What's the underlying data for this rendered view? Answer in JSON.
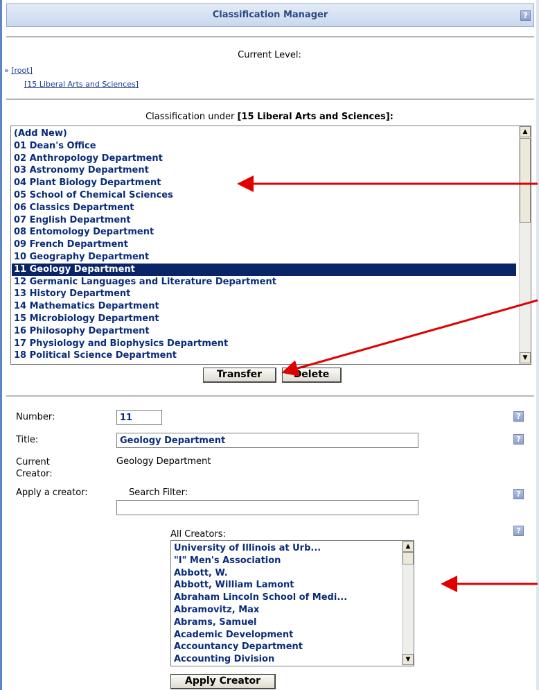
{
  "window": {
    "title": "Classification Manager"
  },
  "level": {
    "heading": "Current Level:",
    "root_prefix": "»",
    "root_link": "[root]",
    "current_link": "[15 Liberal Arts and Sciences]"
  },
  "classification": {
    "heading_prefix": "Classification under ",
    "heading_name": "[15 Liberal Arts and Sciences]",
    "heading_suffix": ":",
    "items": [
      "(Add New)",
      "01 Dean's Office",
      "02 Anthropology Department",
      "03 Astronomy Department",
      "04 Plant Biology Department",
      "05 School of Chemical Sciences",
      "06 Classics Department",
      "07 English Department",
      "08 Entomology Department",
      "09 French Department",
      "10 Geography Department",
      "11 Geology Department",
      "12 Germanic Languages and Literature Department",
      "13 History Department",
      "14 Mathematics Department",
      "15 Microbiology Department",
      "16 Philosophy Department",
      "17 Physiology and Biophysics Department",
      "18 Political Science Department"
    ],
    "selected_index": 11,
    "transfer_label": "Transfer",
    "delete_label": "Delete"
  },
  "form": {
    "number_label": "Number:",
    "number_value": "11",
    "title_label": "Title:",
    "title_value": "Geology Department",
    "current_creator_label": "Current Creator:",
    "current_creator_value": "Geology Department",
    "apply_creator_label": "Apply a creator:",
    "search_filter_label": "Search Filter:",
    "search_filter_value": "",
    "all_creators_label": "All Creators:",
    "creators": [
      "University of Illinois at Urb...",
      "\"I\" Men's Association",
      "Abbott, W.",
      "Abbott, William Lamont",
      "Abraham Lincoln School of Medi...",
      "Abramovitz, Max",
      "Abrams, Samuel",
      "Academic Development",
      "Accountancy Department",
      "Accounting Division"
    ],
    "apply_creator_button": "Apply Creator"
  },
  "icons": {
    "help": "help-icon",
    "scroll_up": "scroll-up-arrow-icon",
    "scroll_down": "scroll-down-arrow-icon"
  },
  "colors": {
    "selection": "#0a2468",
    "item_text": "#0a2c7a",
    "title_text": "#2b4a80",
    "annotation_arrow": "#e00000"
  }
}
